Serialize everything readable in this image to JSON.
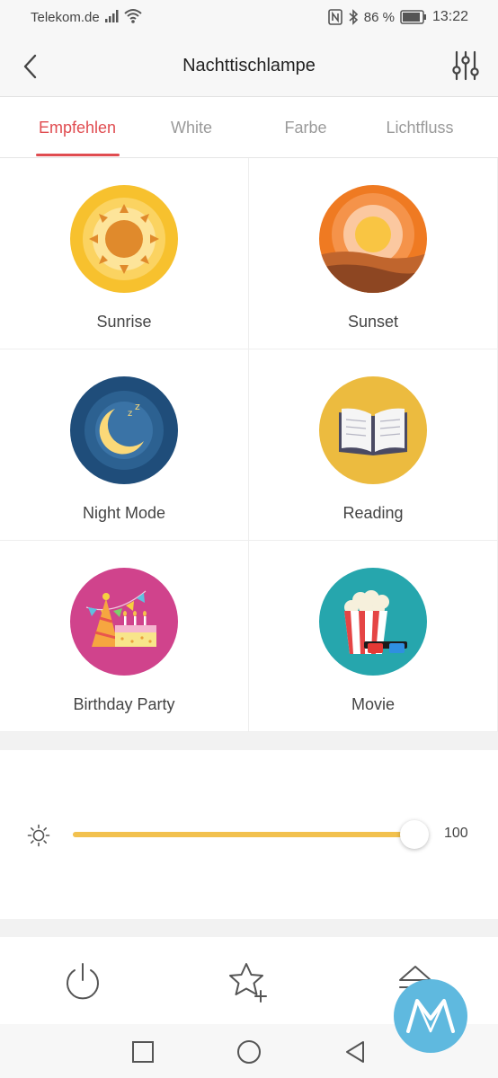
{
  "status": {
    "carrier": "Telekom.de",
    "battery": "86 %",
    "time": "13:22"
  },
  "header": {
    "title": "Nachttischlampe",
    "back_icon": "chevron-left-icon",
    "settings_icon": "sliders-icon"
  },
  "tabs": [
    {
      "label": "Empfehlen",
      "active": true
    },
    {
      "label": "White",
      "active": false
    },
    {
      "label": "Farbe",
      "active": false
    },
    {
      "label": "Lichtfluss",
      "active": false
    }
  ],
  "scenes": [
    {
      "label": "Sunrise",
      "icon": "sunrise-icon"
    },
    {
      "label": "Sunset",
      "icon": "sunset-icon"
    },
    {
      "label": "Night Mode",
      "icon": "night-mode-icon"
    },
    {
      "label": "Reading",
      "icon": "reading-icon"
    },
    {
      "label": "Birthday Party",
      "icon": "birthday-party-icon"
    },
    {
      "label": "Movie",
      "icon": "movie-icon"
    }
  ],
  "brightness": {
    "value": "100",
    "level": 100,
    "max": 100,
    "icon": "brightness-icon"
  },
  "colors": {
    "accent": "#e04c50",
    "slider": "#f2c14e"
  }
}
